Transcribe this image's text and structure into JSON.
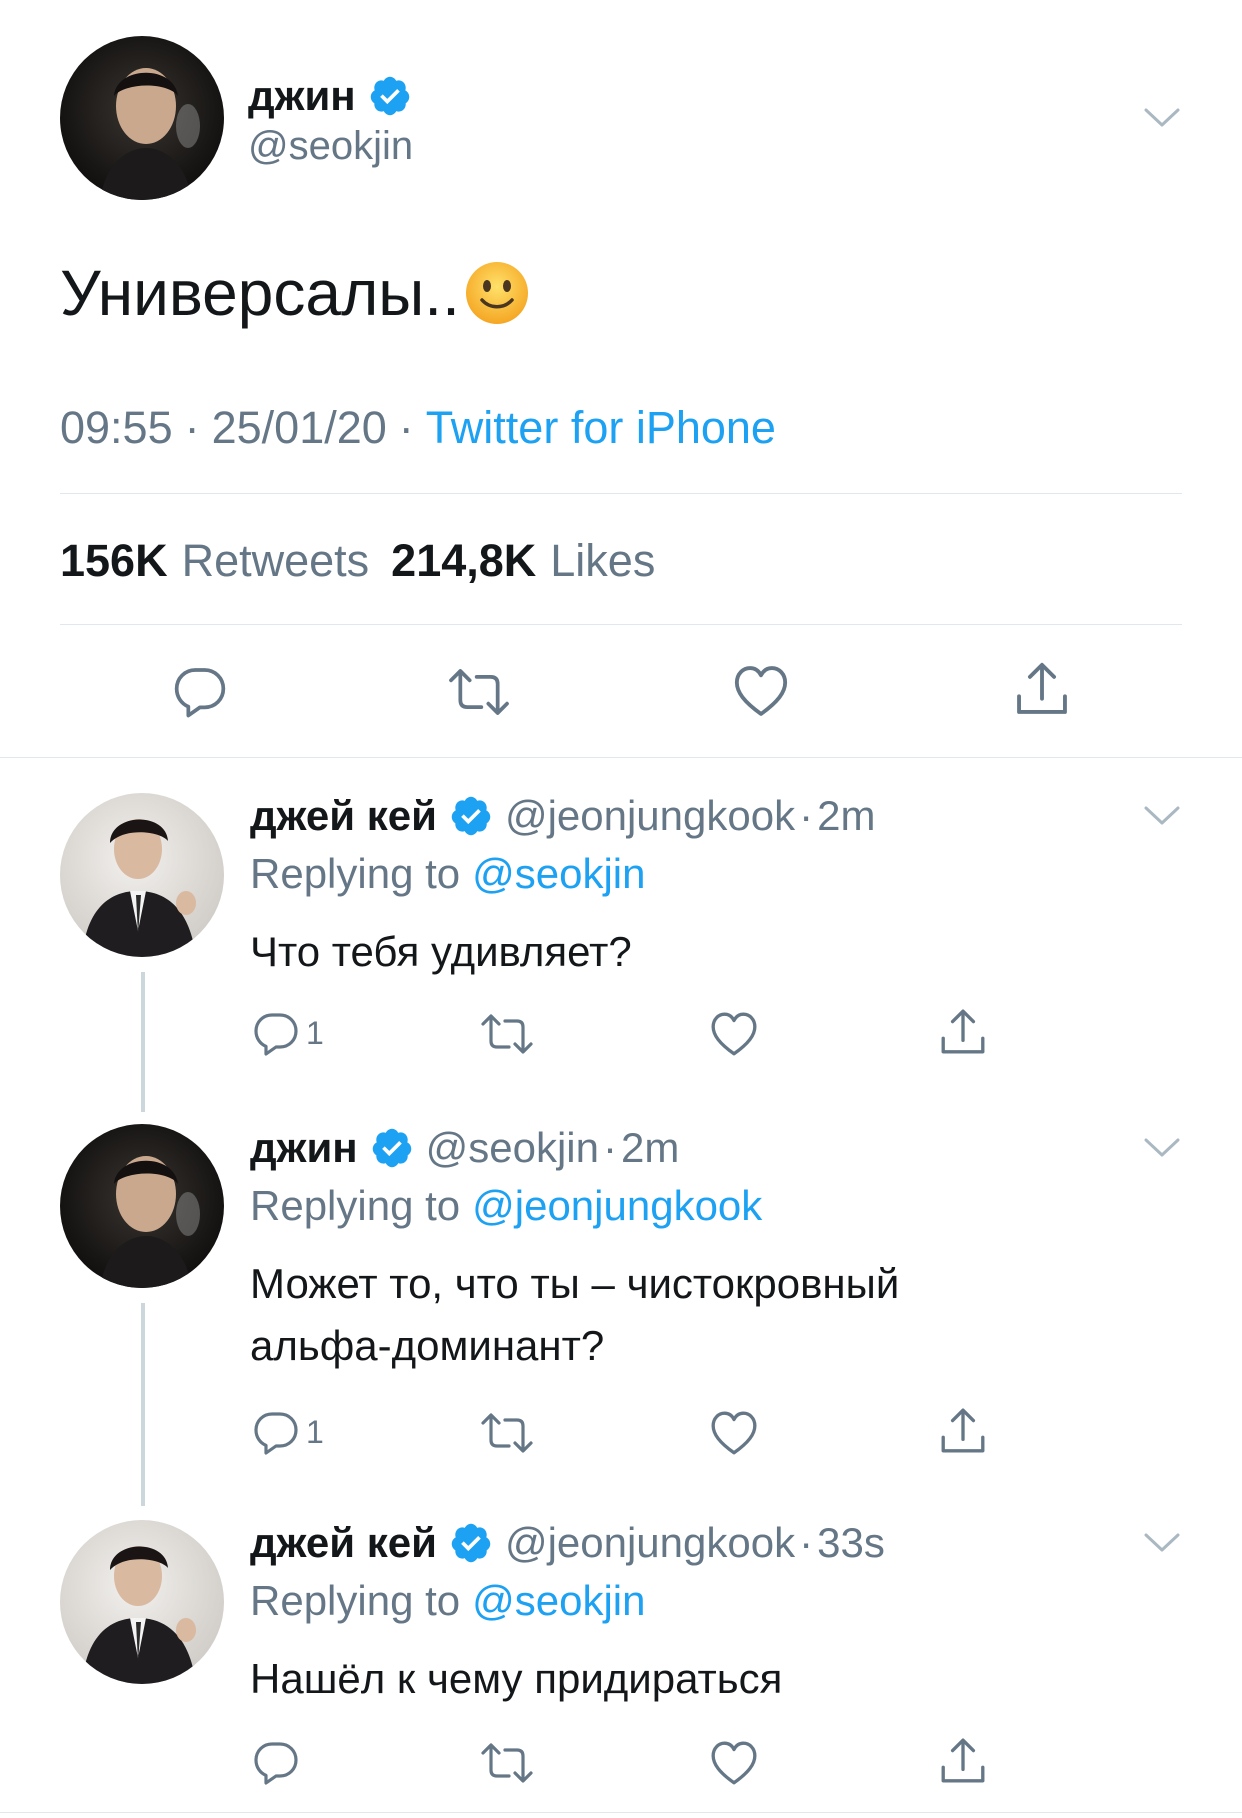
{
  "main_tweet": {
    "name": "джин",
    "handle": "@seokjin",
    "text": "Универсалы..",
    "emoji": "🙂",
    "time": "09:55",
    "date": "25/01/20",
    "sep": "·",
    "source": "Twitter for iPhone",
    "retweets_count": "156K",
    "retweets_label": "Retweets",
    "likes_count": "214,8K",
    "likes_label": "Likes"
  },
  "replies": [
    {
      "name": "джей кей",
      "handle": "@jeonjungkook",
      "time": "2m",
      "replying_prefix": "Replying to",
      "replying_to": "@seokjin",
      "text": "Что тебя удивляет?",
      "reply_count": "1"
    },
    {
      "name": "джин",
      "handle": "@seokjin",
      "time": "2m",
      "replying_prefix": "Replying to",
      "replying_to": "@jeonjungkook",
      "text_line1": "Может то, что ты – чистокровный",
      "text_line2": "альфа-доминант?",
      "reply_count": "1"
    },
    {
      "name": "джей кей",
      "handle": "@jeonjungkook",
      "time": "33s",
      "replying_prefix": "Replying to",
      "replying_to": "@seokjin",
      "text": "Нашёл к чему придираться",
      "reply_count": ""
    }
  ],
  "icons": {
    "verified": "verified-badge-icon",
    "reply": "reply-icon",
    "retweet": "retweet-icon",
    "like": "heart-icon",
    "share": "share-icon",
    "chevron": "chevron-down-icon"
  },
  "colors": {
    "accent": "#1da1f2",
    "text": "#14171a",
    "secondary": "#657786",
    "divider": "#e1e8ed"
  }
}
